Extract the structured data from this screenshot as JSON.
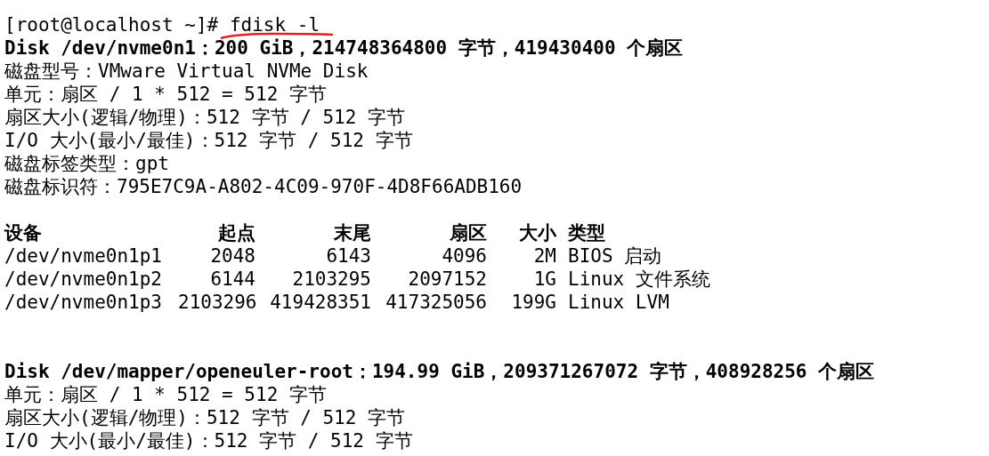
{
  "prompt": {
    "text": "[root@localhost ~]# ",
    "command": "fdisk -l",
    "underlined": true
  },
  "block_1": [
    {
      "kind": "heading",
      "text": "Disk /dev/nvme0n1：200 GiB，214748364800 字节，419430400 个扇区"
    },
    {
      "kind": "text",
      "text": "磁盘型号：VMware Virtual NVMe Disk"
    },
    {
      "kind": "text",
      "text": "单元：扇区 / 1 * 512 = 512 字节"
    },
    {
      "kind": "text",
      "text": "扇区大小(逻辑/物理)：512 字节 / 512 字节"
    },
    {
      "kind": "text",
      "text": "I/O 大小(最小/最佳)：512 字节 / 512 字节"
    },
    {
      "kind": "text",
      "text": "磁盘标签类型：gpt"
    },
    {
      "kind": "text",
      "text": "磁盘标识符：795E7C9A-A802-4C09-970F-4D8F66ADB160"
    }
  ],
  "partition_table": {
    "columns": [
      "设备",
      "起点",
      "末尾",
      "扇区",
      "大小",
      "类型"
    ],
    "rows": [
      [
        "/dev/nvme0n1p1",
        "2048",
        "6143",
        "4096",
        "2M",
        "BIOS 启动"
      ],
      [
        "/dev/nvme0n1p2",
        "6144",
        "2103295",
        "2097152",
        "1G",
        "Linux 文件系统"
      ],
      [
        "/dev/nvme0n1p3",
        "2103296",
        "419428351",
        "417325056",
        "199G",
        "Linux LVM"
      ]
    ]
  },
  "block_2": [
    {
      "kind": "heading",
      "text": "Disk /dev/mapper/openeuler-root：194.99 GiB，209371267072 字节，408928256 个扇区"
    },
    {
      "kind": "text",
      "text": "单元：扇区 / 1 * 512 = 512 字节"
    },
    {
      "kind": "text",
      "text": "扇区大小(逻辑/物理)：512 字节 / 512 字节"
    },
    {
      "kind": "text",
      "text": "I/O 大小(最小/最佳)：512 字节 / 512 字节"
    }
  ]
}
